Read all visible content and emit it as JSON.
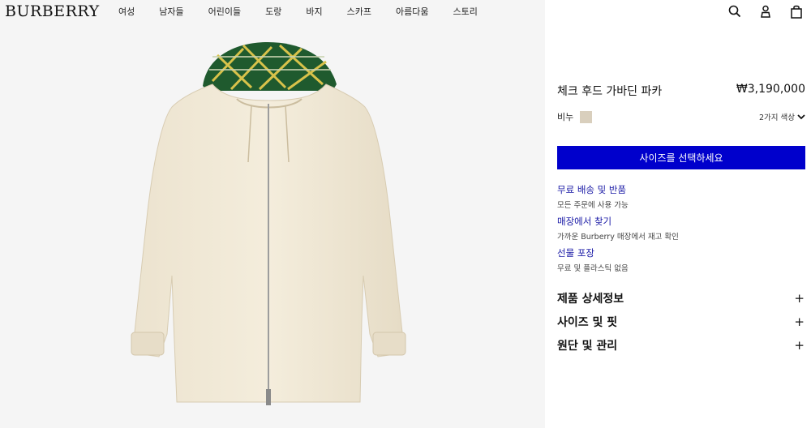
{
  "header": {
    "logo": "BURBERRY",
    "nav": [
      "여성",
      "남자들",
      "어린이들",
      "도랑",
      "바지",
      "스카프",
      "아름다움",
      "스토리"
    ]
  },
  "product": {
    "title": "체크 후드 가바딘 파카",
    "price": "₩3,190,000",
    "color_name": "비누",
    "swatch_color": "#d9cfbd",
    "colors_toggle": "2가지 색상",
    "cta": "사이즈를 선택하세요",
    "cta_color": "#0000cc"
  },
  "services": [
    {
      "link": "무료 배송 및 반품",
      "desc": "모든 주문에 사용 가능"
    },
    {
      "link": "매장에서 찾기",
      "desc": "가까운 Burberry 매장에서 재고 확인"
    },
    {
      "link": "선물 포장",
      "desc": "무료 및 플라스틱 없음"
    }
  ],
  "accordions": [
    {
      "label": "제품 상세정보",
      "icon": "+"
    },
    {
      "label": "사이즈 및 핏",
      "icon": "+"
    },
    {
      "label": "원단 및 관리",
      "icon": "+"
    }
  ],
  "icons": [
    "search-icon",
    "user-icon",
    "shopping-bag-icon",
    "chevron-down-icon",
    "plus-icon"
  ]
}
